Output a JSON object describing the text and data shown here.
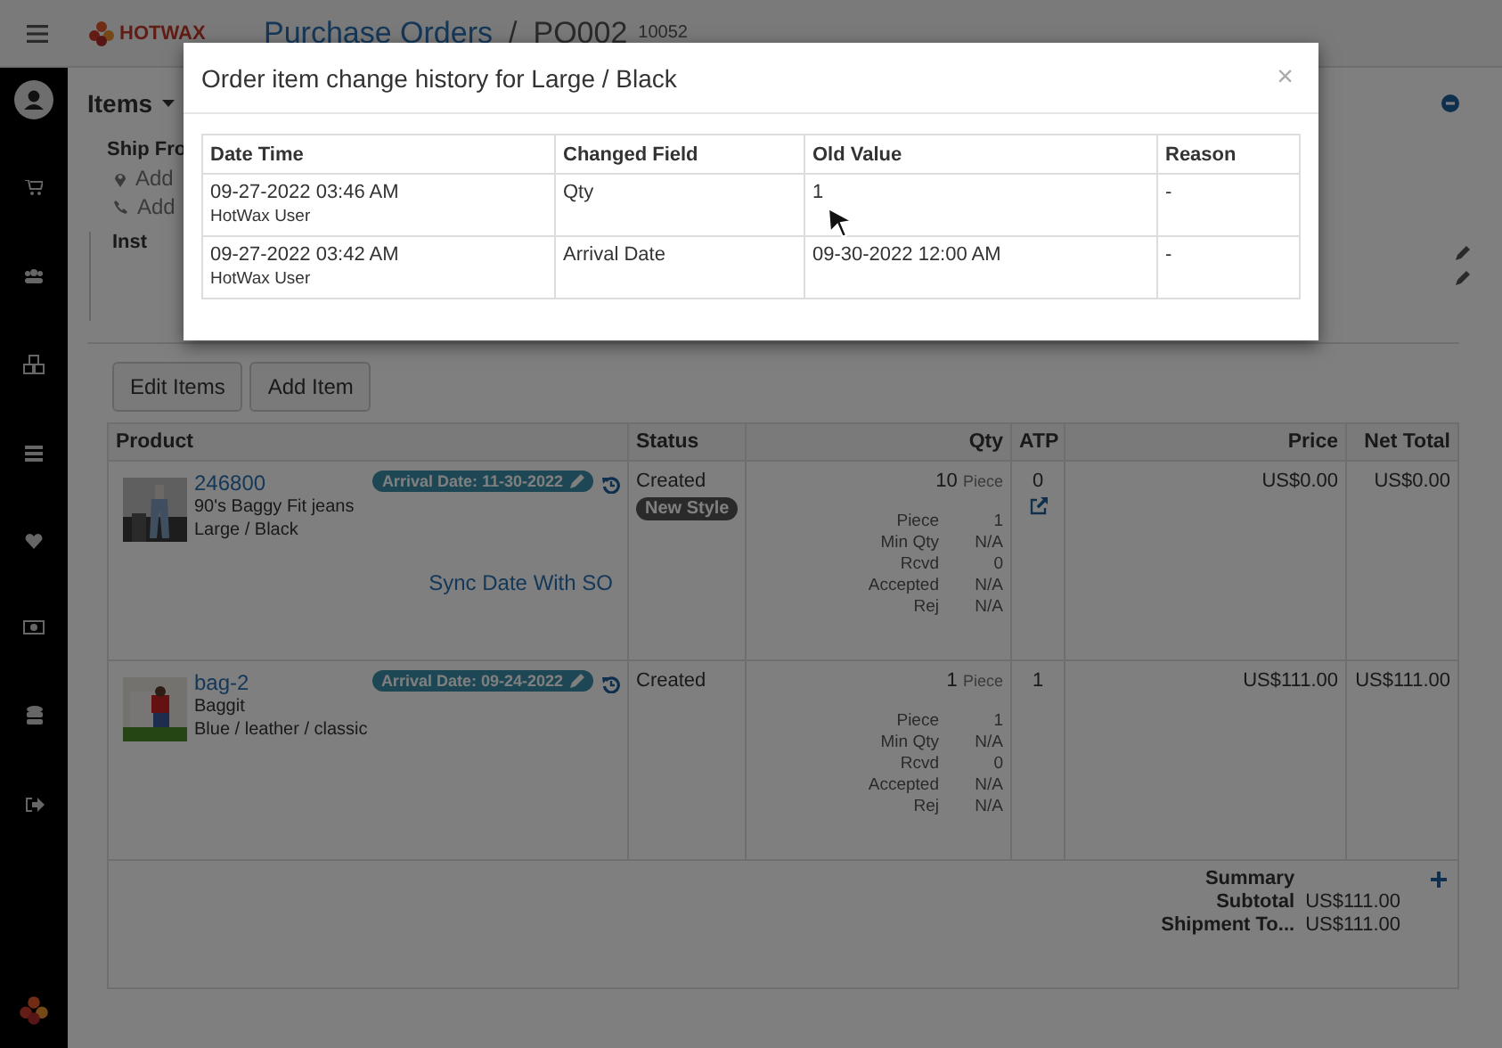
{
  "header": {
    "logo": "HOTWAX",
    "breadcrumb": [
      "Purchase Orders",
      "PO002"
    ],
    "separator": "/",
    "order_id": "10052"
  },
  "section": {
    "title": "Items",
    "ship_from": {
      "label": "Ship Fro",
      "lines": [
        {
          "kind": "location",
          "text": "Add"
        },
        {
          "kind": "phone",
          "text": "Add"
        }
      ]
    },
    "instructions_label": "Inst"
  },
  "buttons": [
    "Edit Items",
    "Add Item"
  ],
  "table": {
    "columns": [
      "Product",
      "Status",
      "Qty",
      "ATP",
      "Price",
      "Net Total"
    ],
    "rows": [
      {
        "product_id": "246800",
        "name": "90's Baggy Fit jeans",
        "variant": "Large / Black",
        "arrival": "Arrival Date: 11-30-2022",
        "sync_link": "Sync Date With SO",
        "status": "Created",
        "tag": "New Style",
        "qty": "10",
        "unit": "Piece",
        "details": [
          {
            "label": "Piece",
            "value": "1"
          },
          {
            "label": "Min Qty",
            "value": "N/A"
          },
          {
            "label": "Rcvd",
            "value": "0"
          },
          {
            "label": "Accepted",
            "value": "N/A"
          },
          {
            "label": "Rej",
            "value": "N/A"
          }
        ],
        "atp": "0",
        "atp_link": true,
        "price": "US$0.00",
        "net_total": "US$0.00"
      },
      {
        "product_id": "bag-2",
        "name": "Baggit",
        "variant": "Blue / leather / classic",
        "arrival": "Arrival Date: 09-24-2022",
        "status": "Created",
        "qty": "1",
        "unit": "Piece",
        "details": [
          {
            "label": "Piece",
            "value": "1"
          },
          {
            "label": "Min Qty",
            "value": "N/A"
          },
          {
            "label": "Rcvd",
            "value": "0"
          },
          {
            "label": "Accepted",
            "value": "N/A"
          },
          {
            "label": "Rej",
            "value": "N/A"
          }
        ],
        "atp": "1",
        "atp_link": false,
        "price": "US$111.00",
        "net_total": "US$111.00"
      }
    ]
  },
  "summary": {
    "title": "Summary",
    "lines": [
      {
        "label": "Subtotal",
        "value": "US$111.00"
      },
      {
        "label": "Shipment To...",
        "value": "US$111.00"
      }
    ]
  },
  "modal": {
    "title": "Order item change history for Large / Black",
    "close": "×",
    "columns": [
      "Date Time",
      "Changed Field",
      "Old Value",
      "Reason"
    ],
    "rows": [
      {
        "date": "09-27-2022 03:46 AM",
        "user": "HotWax User",
        "field": "Qty",
        "old_value": "1",
        "reason": "-"
      },
      {
        "date": "09-27-2022 03:42 AM",
        "user": "HotWax User",
        "field": "Arrival Date",
        "old_value": "09-30-2022 12:00 AM",
        "reason": "-"
      }
    ]
  }
}
